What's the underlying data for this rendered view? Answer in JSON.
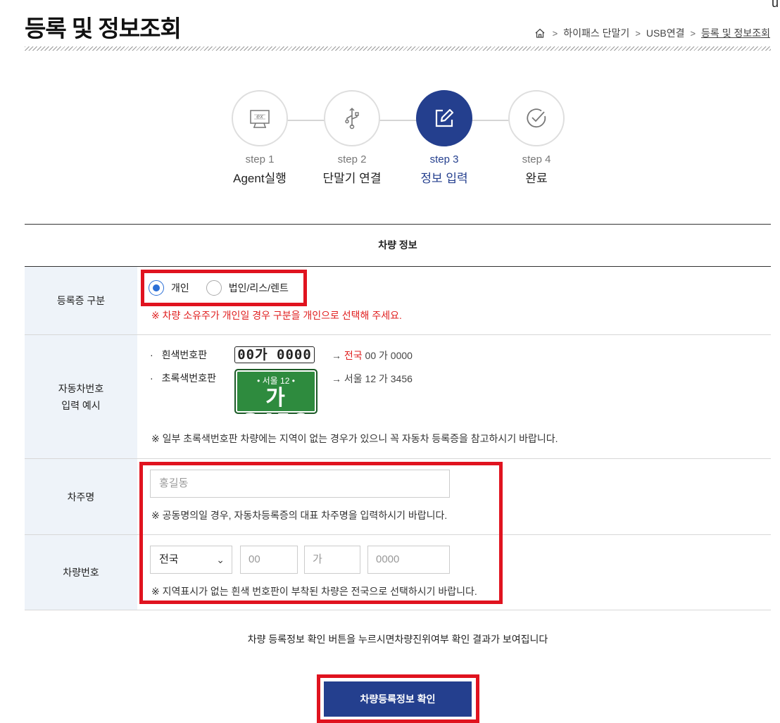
{
  "corner_glyph": "u",
  "header": {
    "title": "등록 및 정보조회",
    "breadcrumb": [
      "하이패스 단말기",
      "USB연결",
      "등록 및 정보조회"
    ]
  },
  "steps": [
    {
      "num": "step 1",
      "name": "Agent실행",
      "icon": "ex-monitor-icon",
      "active": false
    },
    {
      "num": "step 2",
      "name": "단말기 연결",
      "icon": "usb-icon",
      "active": false
    },
    {
      "num": "step 3",
      "name": "정보 입력",
      "icon": "edit-icon",
      "active": true
    },
    {
      "num": "step 4",
      "name": "완료",
      "icon": "check-circle-icon",
      "active": false
    }
  ],
  "section_title": "차량 정보",
  "rows": {
    "reg_type": {
      "label": "등록증 구분",
      "options": [
        "개인",
        "법인/리스/렌트"
      ],
      "selected": "개인",
      "note": "※ 차량 소유주가 개인일 경우 구분을 개인으로 선택해 주세요."
    },
    "plate_example": {
      "label_line1": "자동차번호",
      "label_line2": "입력 예시",
      "white_label": "흰색번호판",
      "white_plate": "00가 0000",
      "white_example_prefix": "→ ",
      "white_example_region": "전국",
      "white_example_rest": " 00 가 0000",
      "green_label": "초록색번호판",
      "green_plate_top": "•  서울 12  •",
      "green_plate_bottom": "가3456",
      "green_example": "→ 서울 12 가 3456",
      "note": "※ 일부 초록색번호판 차량에는 지역이 없는 경우가 있으니 꼭 자동차 등록증을 참고하시기 바랍니다."
    },
    "owner": {
      "label": "차주명",
      "placeholder": "홍길동",
      "note": "※ 공동명의일 경우, 자동차등록증의 대표 차주명을 입력하시기 바랍니다."
    },
    "plate_number": {
      "label": "차량번호",
      "region_value": "전국",
      "num1_placeholder": "00",
      "hangul_placeholder": "가",
      "num2_placeholder": "0000",
      "note": "※ 지역표시가 없는 흰색 번호판이 부착된 차량은 전국으로 선택하시기 바랍니다."
    }
  },
  "footer_message": "차량 등록정보 확인 버튼을 누르시면차량진위여부 확인 결과가 보여집니다",
  "confirm_button": "차량등록정보 확인",
  "colors": {
    "primary": "#243f8e",
    "highlight": "#e0131f",
    "radio": "#2b6fd6",
    "th_bg": "#eef3f9"
  }
}
